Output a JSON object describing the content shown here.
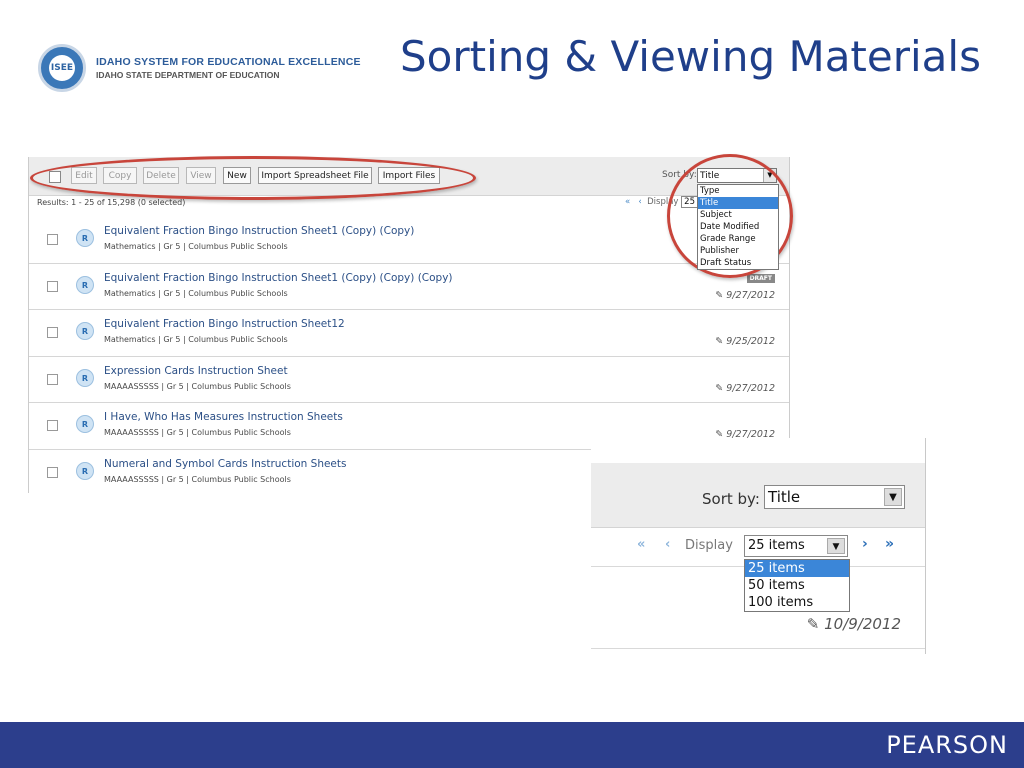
{
  "logo": {
    "seal_text": "ISEE",
    "line1": "IDAHO SYSTEM FOR EDUCATIONAL EXCELLENCE",
    "line2": "IDAHO STATE DEPARTMENT OF EDUCATION"
  },
  "slide_title": "Sorting & Viewing Materials",
  "toolbar": {
    "buttons": [
      {
        "label": "Edit",
        "enabled": false
      },
      {
        "label": "Copy",
        "enabled": false
      },
      {
        "label": "Delete",
        "enabled": false
      },
      {
        "label": "View",
        "enabled": false
      },
      {
        "label": "New",
        "enabled": true
      },
      {
        "label": "Import Spreadsheet File",
        "enabled": true
      },
      {
        "label": "Import Files",
        "enabled": true
      }
    ],
    "sort_label": "Sort by:",
    "sort_value": "Title",
    "sort_options": [
      "Type",
      "Title",
      "Subject",
      "Date Modified",
      "Grade Range",
      "Publisher",
      "Draft Status"
    ],
    "sort_selected": "Title"
  },
  "results_text": "Results: 1 - 25 of 15,298 (0 selected)",
  "pager": {
    "display_label": "Display",
    "display_value": "25"
  },
  "rows": [
    {
      "icon": "R",
      "title": "Equivalent Fraction Bingo Instruction Sheet1 (Copy) (Copy)",
      "meta": "Mathematics  |  Gr 5  |  Columbus Public Schools",
      "date": "",
      "badge": ""
    },
    {
      "icon": "R",
      "title": "Equivalent Fraction Bingo Instruction Sheet1 (Copy) (Copy) (Copy)",
      "meta": "Mathematics  |  Gr 5  |  Columbus Public Schools",
      "date": "9/27/2012",
      "badge": "DRAFT"
    },
    {
      "icon": "R",
      "title": "Equivalent Fraction Bingo Instruction Sheet12",
      "meta": "Mathematics  |  Gr 5  |  Columbus Public Schools",
      "date": "9/25/2012",
      "badge": ""
    },
    {
      "icon": "R",
      "title": "Expression Cards Instruction Sheet",
      "meta": "MAAAASSSSS  |  Gr 5  |  Columbus Public Schools",
      "date": "9/27/2012",
      "badge": ""
    },
    {
      "icon": "R",
      "title": "I Have, Who Has Measures Instruction Sheets",
      "meta": "MAAAASSSSS  |  Gr 5  |  Columbus Public Schools",
      "date": "9/27/2012",
      "badge": ""
    },
    {
      "icon": "R",
      "title": "Numeral and Symbol Cards Instruction Sheets",
      "meta": "MAAAASSSSS  |  Gr 5  |  Columbus Public Schools",
      "date": "",
      "badge": ""
    }
  ],
  "inset": {
    "sort_label": "Sort by:",
    "sort_value": "Title",
    "display_label": "Display",
    "display_value": "25 items",
    "display_options": [
      "25 items",
      "50 items",
      "100 items"
    ],
    "display_selected": "25 items",
    "date": "10/9/2012"
  },
  "footer": {
    "brand": "PEARSON"
  },
  "colors": {
    "accent_blue": "#3b86d8",
    "title_blue": "#1f3f8a",
    "footer": "#2c3e8c",
    "highlight_ring": "#c8453b"
  }
}
